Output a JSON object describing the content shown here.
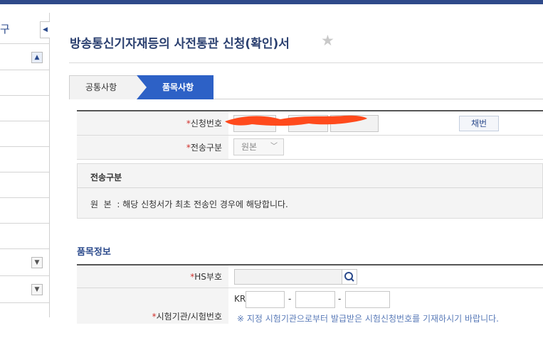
{
  "sidebar": {
    "head_text": "구",
    "collapse_icon": "◀"
  },
  "page": {
    "title": "방송통신기자재등의 사전통관 신청(확인)서",
    "favorite_icon": "star-icon"
  },
  "tabs": [
    {
      "label": "공통사항",
      "active": false
    },
    {
      "label": "품목사항",
      "active": true
    }
  ],
  "form": {
    "application_number_label": "신청번호",
    "assign_button": "채번",
    "transmission_type_label": "전송구분",
    "transmission_type_value": "원본",
    "required_mark": "*"
  },
  "info": {
    "title": "전송구분",
    "text": "원  본  : 해당 신청서가 최초 전송인 경우에 해당합니다."
  },
  "items_section": {
    "title": "품목정보",
    "hs_label": "HS부호",
    "test_label": "시험기관/시험번호",
    "kr_prefix": "KR",
    "dash": "-",
    "notice": "※ 지정 시험기관으로부터 발급받은 시험신청번호를 기재하시기 바랍니다."
  },
  "colors": {
    "brand": "#2b4a8c",
    "active_tab": "#2d61c6",
    "required": "#d0312d",
    "redaction": "#ff4a1c"
  }
}
